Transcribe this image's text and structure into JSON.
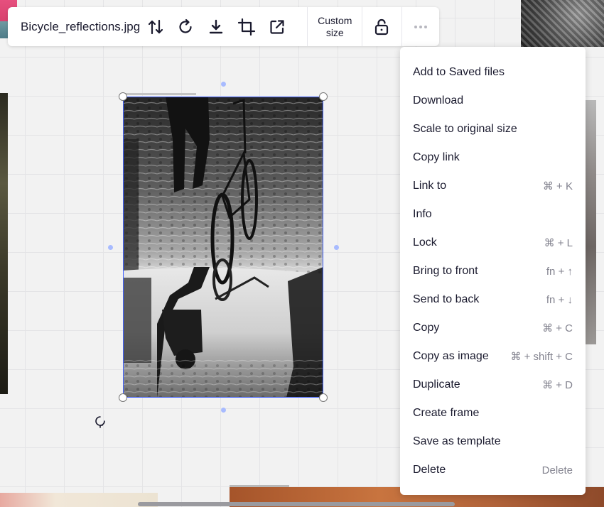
{
  "toolbar": {
    "filename": "Bicycle_reflections.jpg",
    "custom_size_line1": "Custom",
    "custom_size_line2": "size",
    "icons": [
      "flip-icon",
      "rotate-icon",
      "download-icon",
      "crop-icon",
      "open-external-icon",
      "unlock-icon",
      "more-icon"
    ]
  },
  "context_menu": {
    "items": [
      {
        "label": "Add to Saved files",
        "shortcut": ""
      },
      {
        "label": "Download",
        "shortcut": ""
      },
      {
        "label": "Scale to original size",
        "shortcut": ""
      },
      {
        "label": "Copy link",
        "shortcut": ""
      },
      {
        "label": "Link to",
        "shortcut": "⌘ + K"
      },
      {
        "label": "Info",
        "shortcut": ""
      },
      {
        "label": "Lock",
        "shortcut": "⌘ + L"
      },
      {
        "label": "Bring to front",
        "shortcut": "fn + ↑"
      },
      {
        "label": "Send to back",
        "shortcut": "fn + ↓"
      },
      {
        "label": "Copy",
        "shortcut": "⌘ + C"
      },
      {
        "label": "Copy as image",
        "shortcut": "⌘ + shift + C"
      },
      {
        "label": "Duplicate",
        "shortcut": "⌘ + D"
      },
      {
        "label": "Create frame",
        "shortcut": ""
      },
      {
        "label": "Save as template",
        "shortcut": ""
      },
      {
        "label": "Delete",
        "shortcut": "Delete"
      }
    ]
  },
  "colors": {
    "selection": "#4262ff",
    "canvas_bg": "#f2f2f2",
    "text": "#1a1a2e",
    "shortcut_text": "#83838f"
  }
}
